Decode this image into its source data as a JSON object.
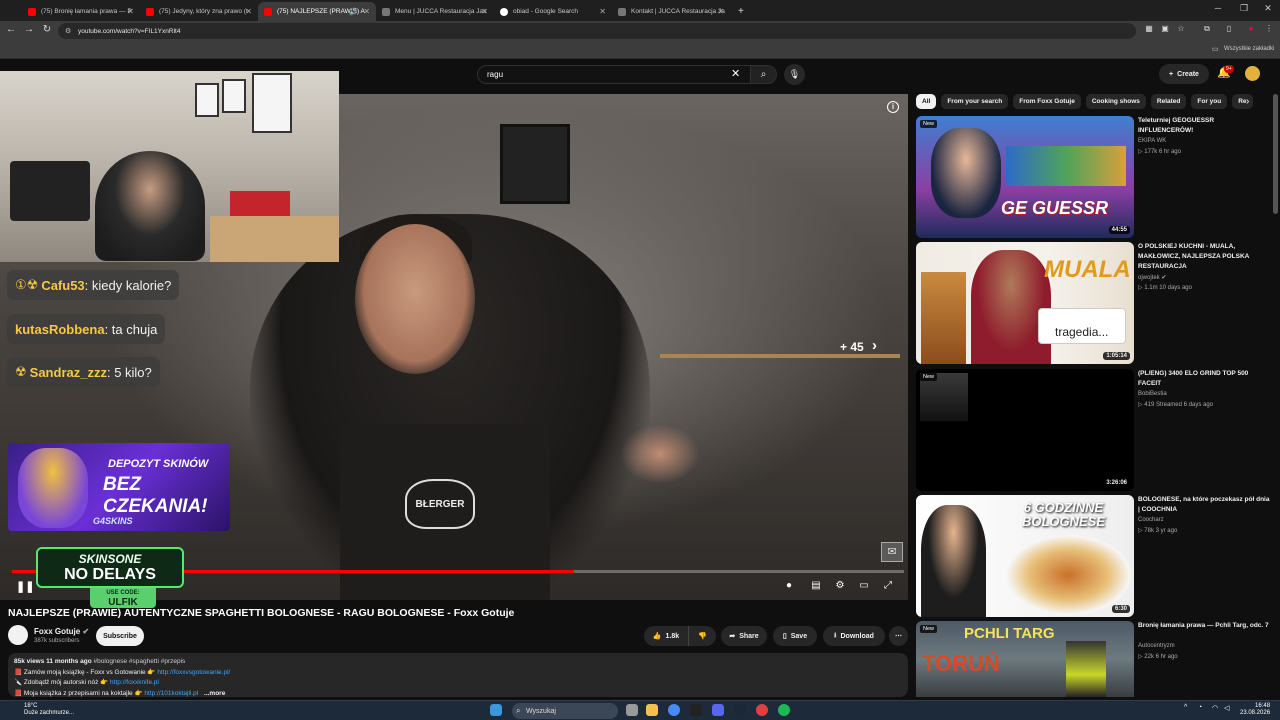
{
  "browser": {
    "tabs": [
      {
        "label": "(75) Bronię łamania prawa — P",
        "active": false
      },
      {
        "label": "(75) Jedyny, który zna prawo (t",
        "active": false
      },
      {
        "label": "(75) NAJLEPSZE (PRAWIE) A",
        "active": true
      },
      {
        "label": "Menu | JUCCA Restauracja Jas",
        "active": false
      },
      {
        "label": "obiad - Google Search",
        "active": false
      },
      {
        "label": "Kontakt | JUCCA Restauracja Ja",
        "active": false
      }
    ],
    "new_tab": "+",
    "url": "youtube.com/watch?v=FIL1YxnRlt4",
    "bookmarks_label": "Wszystkie zakładki"
  },
  "header": {
    "search_value": "ragu",
    "create_label": "Create",
    "notif_count": "9+"
  },
  "video": {
    "overlay_more": "+ 45",
    "progress": 0.63,
    "chat": [
      {
        "user": "Cafu53",
        "msg": ": kiedy kalorie?"
      },
      {
        "user": "kutasRobbena",
        "msg": ": ta chuja"
      },
      {
        "user": "Sandraz_zzz",
        "msg": ": 5 kilo?"
      }
    ],
    "ad": {
      "line1": "DEPOZYT SKINÓW",
      "line2": "BEZ CZEKANIA!",
      "brand": "G4SKINS"
    },
    "promo": {
      "line1": "SKINSONE",
      "line2": "NO DELAYS",
      "code_label": "USE CODE:",
      "code": "ULFIK"
    },
    "apron_logo": "BŁERGER"
  },
  "info": {
    "title": "NAJLEPSZE (PRAWIE) AUTENTYCZNE SPAGHETTI BOLOGNESE - RAGU BOLOGNESE - Foxx Gotuje",
    "channel": "Foxx Gotuje",
    "subscribers": "387k subscribers",
    "subscribe_label": "Subscribe",
    "likes": "1.8k",
    "share_label": "Share",
    "save_label": "Save",
    "download_label": "Download",
    "desc_meta": "85k views  11 months ago",
    "desc_tags": "#bolognese #spaghetti #przepis",
    "desc_line1": "📕 Zamów moją książkę - Foxx vs Gotowanie 👉",
    "desc_link1": "http://foxxvsgotowanie.pl/",
    "desc_line2": "🔪 Zdobądź mój autorski nóż 👉",
    "desc_link2": "http://foxxknife.pl",
    "desc_line3": "📕 Moja książka z przepisami na koktajle 👉",
    "desc_link3": "http://101koktajli.pl",
    "more_label": "...more"
  },
  "chips": [
    "All",
    "From your search",
    "From Foxx Gotuje",
    "Cooking shows",
    "Related",
    "For you",
    "Re"
  ],
  "recommendations": [
    {
      "title": "Teleturniej GEOGUESSR INFLUENCERÓW!",
      "channel": "EKIPA WK",
      "meta": "177k  6 hr ago",
      "duration": "44:55",
      "new": "New",
      "thumb_text": "GE GUESSR"
    },
    {
      "title": "O POLSKIEJ KUCHNI - MUALA, MAKŁOWICZ, NAJLEPSZA POLSKA RESTAURACJA",
      "channel": "ojwojtek",
      "meta": "1.1m  10 days ago",
      "duration": "1:05:14",
      "new": "",
      "thumb_text": "MUALA"
    },
    {
      "title": "(PL/ENG) 3400 ELO GRIND TOP 500 FACEIT",
      "channel": "BobiBestia",
      "meta": "419  Streamed 6 days ago",
      "duration": "3:26:06",
      "new": "New",
      "thumb_text": ""
    },
    {
      "title": "BOLOGNESE, na które poczekasz pół dnia | COOCHNIA",
      "channel": "Coocharz",
      "meta": "78k  3 yr ago",
      "duration": "6:30",
      "new": "",
      "thumb_text": "6 GODZINNE BOLOGNESE"
    },
    {
      "title": "Bronię łamania prawa — Pchli Targ, odc. 7",
      "channel": "Autocentryzm",
      "meta": "22k  6 hr ago",
      "duration": "",
      "new": "New",
      "thumb_text": "PCHLI TARG"
    }
  ],
  "taskbar": {
    "temp": "18°C",
    "weather": "Duże zachmurze...",
    "search_placeholder": "Wyszukaj",
    "time": "16:48",
    "date": "23.08.2026"
  }
}
